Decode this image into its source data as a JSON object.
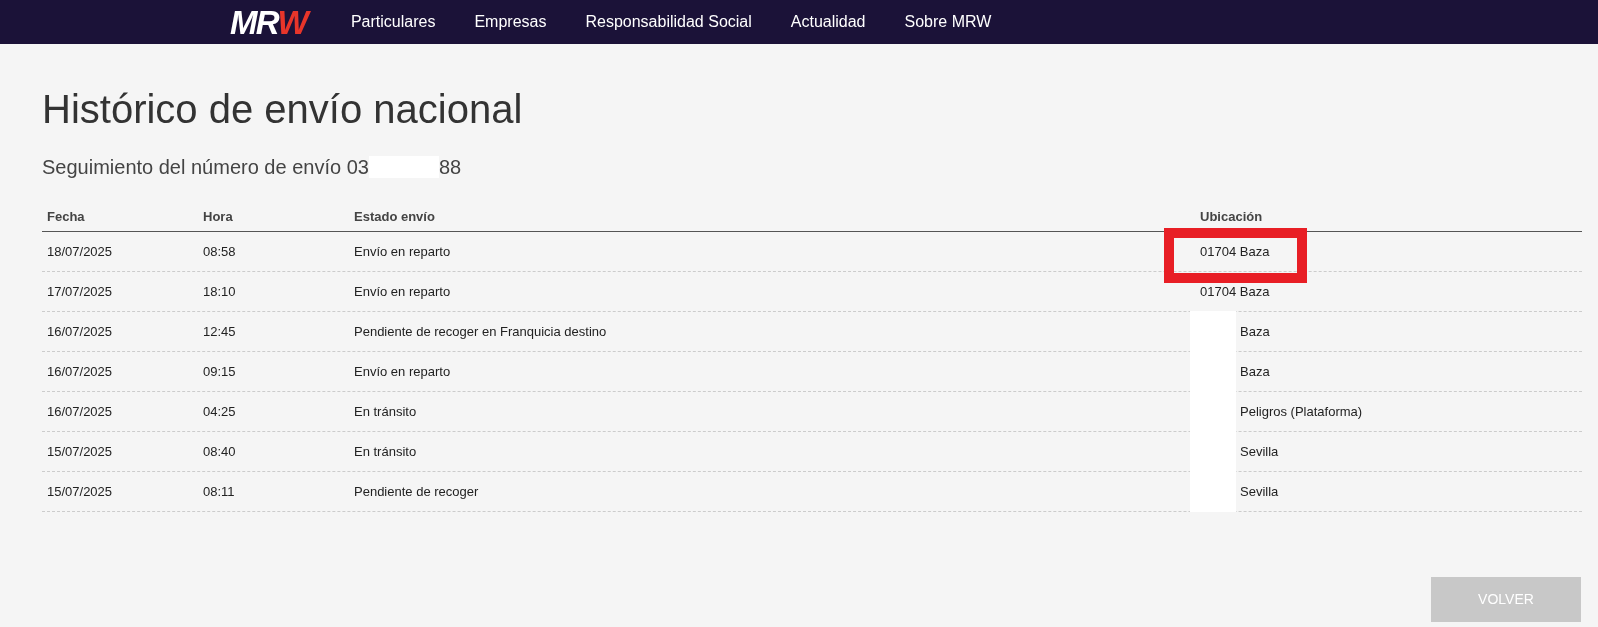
{
  "nav": {
    "logo": {
      "text": "MR",
      "accent": "W"
    },
    "items": [
      "Particulares",
      "Empresas",
      "Responsabilidad Social",
      "Actualidad",
      "Sobre MRW"
    ]
  },
  "title": "Histórico de envío nacional",
  "subtitle": {
    "before": "Seguimiento del número de envío 03",
    "redacted": true,
    "after": "88"
  },
  "table": {
    "columns": [
      "Fecha",
      "Hora",
      "Estado envío",
      "Ubicación"
    ],
    "rows": [
      {
        "date": "18/07/2025",
        "time": "08:58",
        "status": "Envío en reparto",
        "location": "01704 Baza",
        "redacted": false,
        "highlighted": true
      },
      {
        "date": "17/07/2025",
        "time": "18:10",
        "status": "Envío en reparto",
        "location": "01704 Baza",
        "redacted": false,
        "highlighted": false
      },
      {
        "date": "16/07/2025",
        "time": "12:45",
        "status": "Pendiente de recoger en Franquicia destino",
        "location": "Baza",
        "redacted": true,
        "highlighted": false
      },
      {
        "date": "16/07/2025",
        "time": "09:15",
        "status": "Envío en reparto",
        "location": "Baza",
        "redacted": true,
        "highlighted": false
      },
      {
        "date": "16/07/2025",
        "time": "04:25",
        "status": "En tránsito",
        "location": "Peligros (Plataforma)",
        "redacted": true,
        "highlighted": false
      },
      {
        "date": "15/07/2025",
        "time": "08:40",
        "status": "En tránsito",
        "location": "Sevilla",
        "redacted": true,
        "highlighted": false
      },
      {
        "date": "15/07/2025",
        "time": "08:11",
        "status": "Pendiente de recoger",
        "location": "Sevilla",
        "redacted": true,
        "highlighted": false
      }
    ]
  },
  "button": {
    "label": "VOLVER",
    "disabled": true
  }
}
